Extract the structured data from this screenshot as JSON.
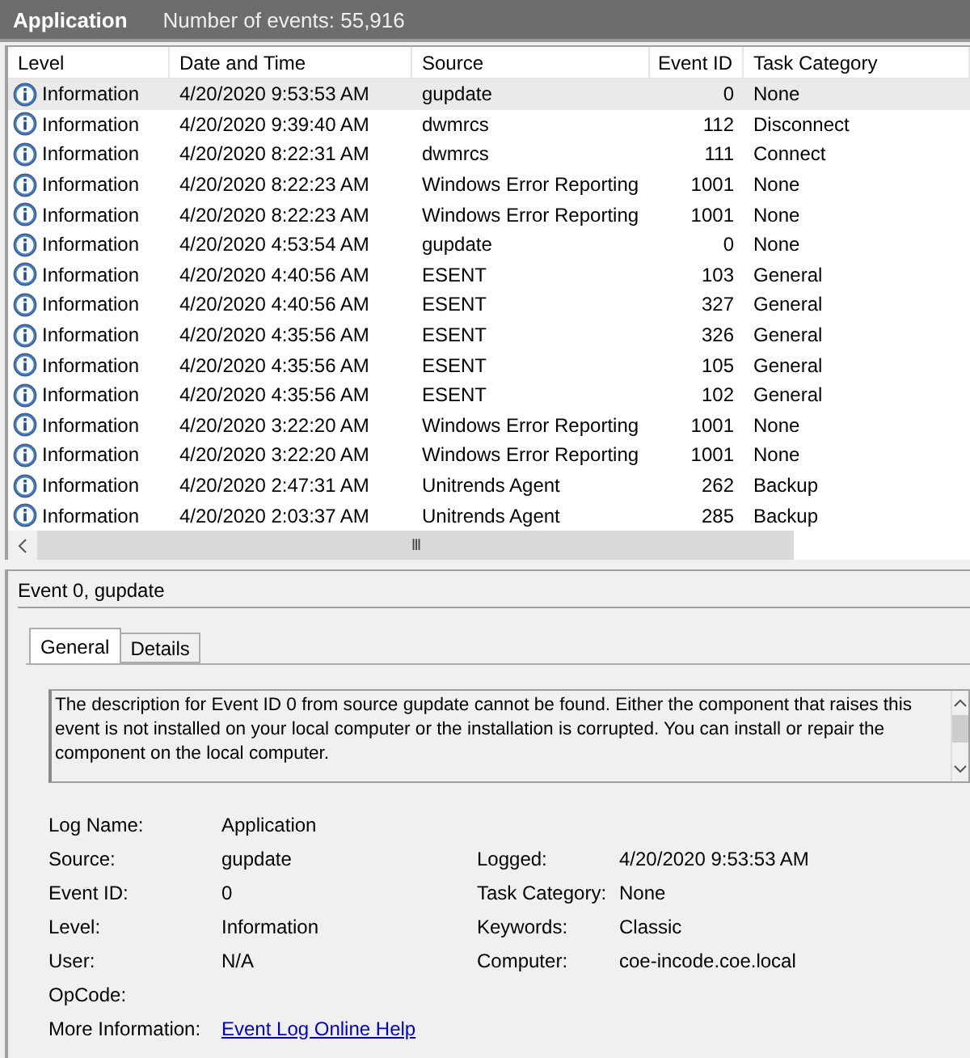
{
  "header": {
    "title": "Application",
    "count": "Number of events: 55,916"
  },
  "table": {
    "columns": [
      "Level",
      "Date and Time",
      "Source",
      "Event ID",
      "Task Category"
    ],
    "rows": [
      {
        "level": "Information",
        "date": "4/20/2020 9:53:53 AM",
        "source": "gupdate",
        "event_id": "0",
        "category": "None",
        "selected": true
      },
      {
        "level": "Information",
        "date": "4/20/2020 9:39:40 AM",
        "source": "dwmrcs",
        "event_id": "112",
        "category": "Disconnect",
        "selected": false
      },
      {
        "level": "Information",
        "date": "4/20/2020 8:22:31 AM",
        "source": "dwmrcs",
        "event_id": "111",
        "category": "Connect",
        "selected": false
      },
      {
        "level": "Information",
        "date": "4/20/2020 8:22:23 AM",
        "source": "Windows Error Reporting",
        "event_id": "1001",
        "category": "None",
        "selected": false
      },
      {
        "level": "Information",
        "date": "4/20/2020 8:22:23 AM",
        "source": "Windows Error Reporting",
        "event_id": "1001",
        "category": "None",
        "selected": false
      },
      {
        "level": "Information",
        "date": "4/20/2020 4:53:54 AM",
        "source": "gupdate",
        "event_id": "0",
        "category": "None",
        "selected": false
      },
      {
        "level": "Information",
        "date": "4/20/2020 4:40:56 AM",
        "source": "ESENT",
        "event_id": "103",
        "category": "General",
        "selected": false
      },
      {
        "level": "Information",
        "date": "4/20/2020 4:40:56 AM",
        "source": "ESENT",
        "event_id": "327",
        "category": "General",
        "selected": false
      },
      {
        "level": "Information",
        "date": "4/20/2020 4:35:56 AM",
        "source": "ESENT",
        "event_id": "326",
        "category": "General",
        "selected": false
      },
      {
        "level": "Information",
        "date": "4/20/2020 4:35:56 AM",
        "source": "ESENT",
        "event_id": "105",
        "category": "General",
        "selected": false
      },
      {
        "level": "Information",
        "date": "4/20/2020 4:35:56 AM",
        "source": "ESENT",
        "event_id": "102",
        "category": "General",
        "selected": false
      },
      {
        "level": "Information",
        "date": "4/20/2020 3:22:20 AM",
        "source": "Windows Error Reporting",
        "event_id": "1001",
        "category": "None",
        "selected": false
      },
      {
        "level": "Information",
        "date": "4/20/2020 3:22:20 AM",
        "source": "Windows Error Reporting",
        "event_id": "1001",
        "category": "None",
        "selected": false
      },
      {
        "level": "Information",
        "date": "4/20/2020 2:47:31 AM",
        "source": "Unitrends Agent",
        "event_id": "262",
        "category": "Backup",
        "selected": false
      },
      {
        "level": "Information",
        "date": "4/20/2020 2:03:37 AM",
        "source": "Unitrends Agent",
        "event_id": "285",
        "category": "Backup",
        "selected": false
      }
    ]
  },
  "scrollbar_grip": "III",
  "details": {
    "title": "Event 0, gupdate",
    "tabs": [
      {
        "label": "General",
        "selected": true
      },
      {
        "label": "Details",
        "selected": false
      }
    ],
    "description": "The description for Event ID 0 from source gupdate cannot be found. Either the component that raises this event is not installed on your local computer or the installation is corrupted. You can install or repair the component on the local computer.",
    "fields": [
      {
        "label": "Log Name:",
        "value": "Application"
      },
      {
        "label": "Source:",
        "value": "gupdate",
        "label_2": "Logged:",
        "value_2": "4/20/2020 9:53:53 AM"
      },
      {
        "label": "Event ID:",
        "value": "0",
        "label_2": "Task Category:",
        "value_2": "None"
      },
      {
        "label": "Level:",
        "value": "Information",
        "label_2": "Keywords:",
        "value_2": "Classic"
      },
      {
        "label": "User:",
        "value": "N/A",
        "label_2": "Computer:",
        "value_2": "coe-incode.coe.local"
      },
      {
        "label": "OpCode:"
      },
      {
        "label": "More Information:",
        "link": "Event Log Online Help"
      }
    ]
  }
}
